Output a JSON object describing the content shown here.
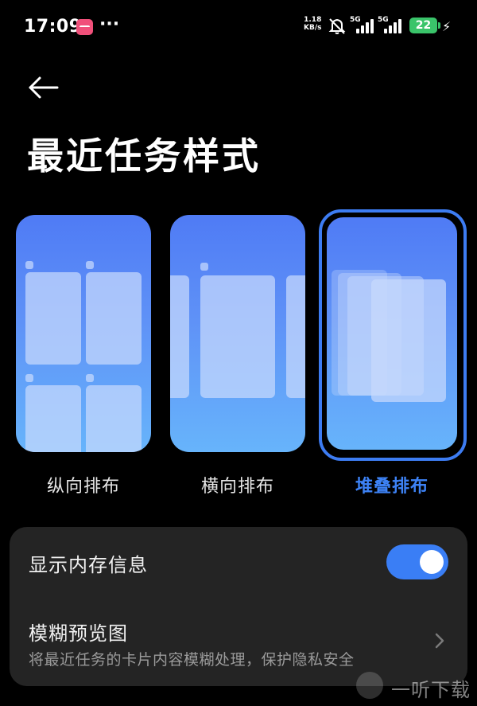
{
  "status_bar": {
    "time": "17:09",
    "more": "···",
    "net_speed_value": "1.18",
    "net_speed_unit": "KB/s",
    "sim1_label": "5G",
    "sim2_label": "5G",
    "battery_level": "22",
    "battery_color": "#3ac46a",
    "icons": [
      "app-notification-icon",
      "mute-icon",
      "signal-icon",
      "battery-icon",
      "charging-icon"
    ]
  },
  "header": {
    "back_icon": "back-arrow-icon",
    "title": "最近任务样式"
  },
  "layout_options": [
    {
      "label": "纵向排布",
      "selected": false
    },
    {
      "label": "横向排布",
      "selected": false
    },
    {
      "label": "堆叠排布",
      "selected": true
    }
  ],
  "settings": {
    "show_memory": {
      "label": "显示内存信息",
      "enabled": true
    },
    "blur_preview": {
      "label": "模糊预览图",
      "description": "将最近任务的卡片内容模糊处理，保护隐私安全"
    }
  },
  "watermark": {
    "text": "一听下载"
  },
  "colors": {
    "accent": "#3d82f5",
    "card_background": "#242424",
    "page_background": "#000000"
  }
}
